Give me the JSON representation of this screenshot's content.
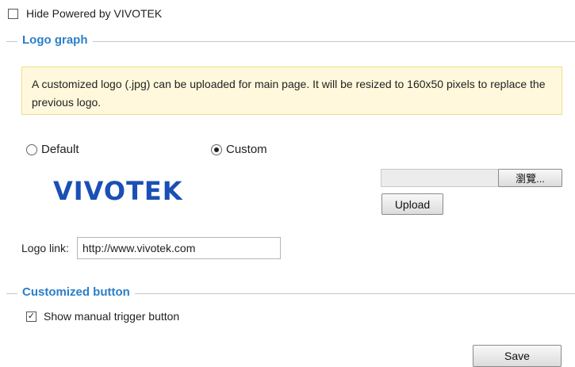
{
  "hide_powered": {
    "label": "Hide Powered by VIVOTEK",
    "checked": false
  },
  "logo_section": {
    "title": "Logo graph",
    "info": "A customized logo (.jpg) can be uploaded for main page. It will be resized to 160x50 pixels to replace the previous logo.",
    "radio_default": "Default",
    "radio_custom": "Custom",
    "selected": "Custom",
    "logo_text": "VIVOTEK",
    "browse_label": "瀏覽...",
    "upload_label": "Upload",
    "logo_link_label": "Logo link:",
    "logo_link_value": "http://www.vivotek.com"
  },
  "button_section": {
    "title": "Customized button",
    "show_trigger_label": "Show manual trigger button",
    "show_trigger_checked": true
  },
  "save_label": "Save",
  "colors": {
    "accent": "#2a7fc9",
    "info_bg": "#fff8dc",
    "logo_blue": "#1a4fb5"
  }
}
